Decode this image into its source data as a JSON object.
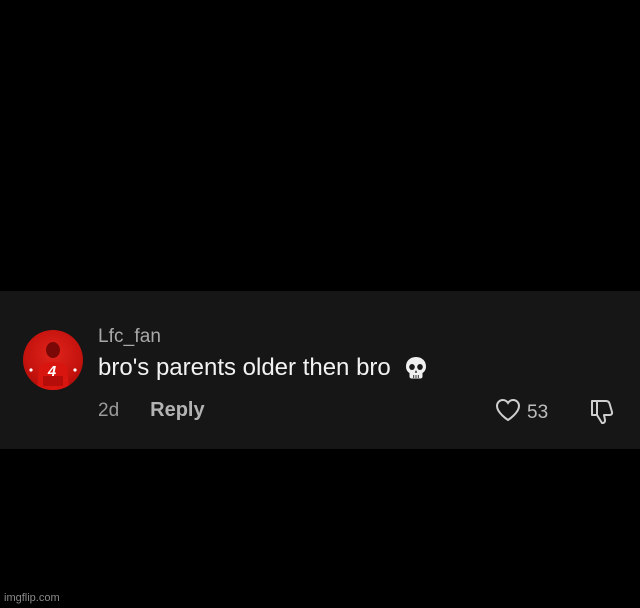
{
  "comment": {
    "username": "Lfc_fan",
    "text": "bro's parents older then bro",
    "emoji": "skull-icon",
    "time_ago": "2d",
    "reply_label": "Reply",
    "like_count": "53",
    "avatar": {
      "description": "avatar-liverpool-player",
      "jersey_number": "4",
      "color": "#c4120d"
    }
  },
  "watermark": "imgflip.com",
  "colors": {
    "background": "#000000",
    "card": "#161616",
    "primary_text": "#f2f2f2",
    "secondary_text": "#a9a9a9"
  }
}
